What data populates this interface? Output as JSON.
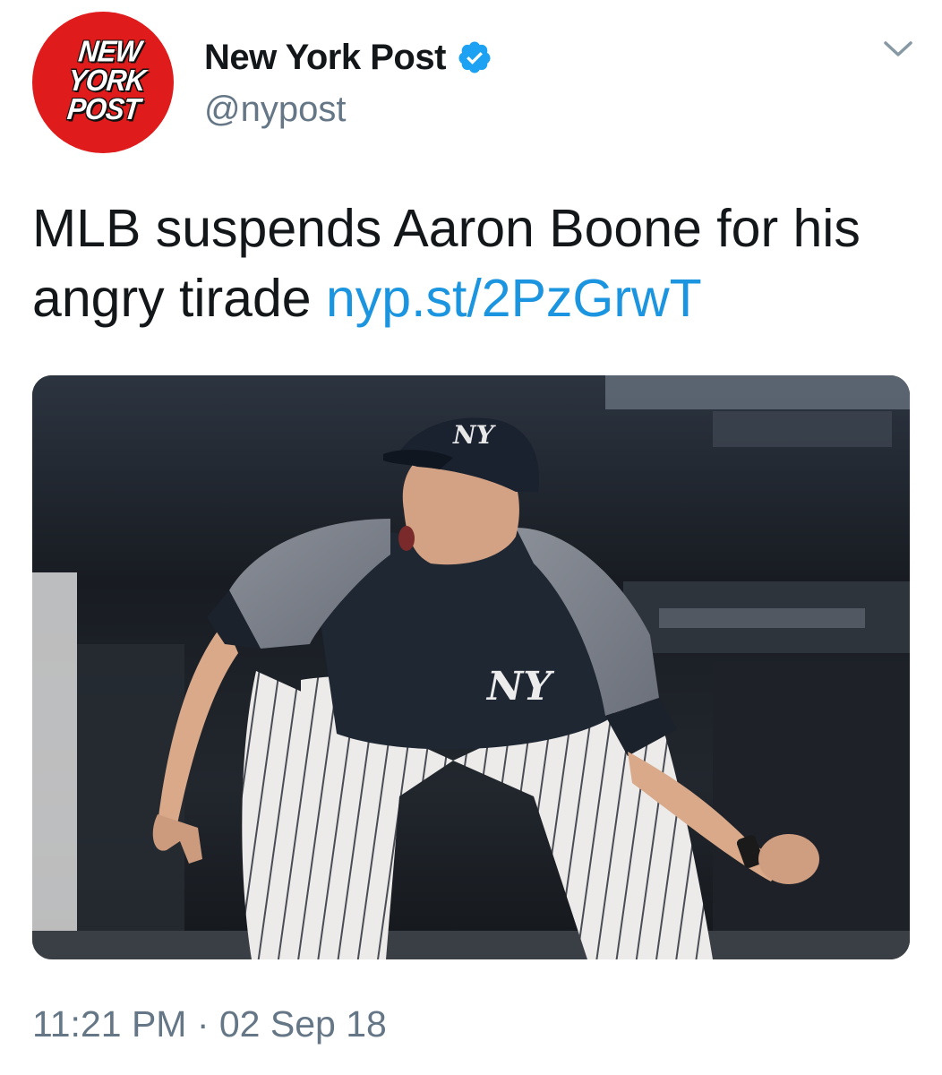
{
  "account": {
    "display_name": "New York Post",
    "handle": "@nypost",
    "verified": true,
    "avatar_logo_lines": [
      "NEW",
      "YORK",
      "POST"
    ],
    "avatar_color": "#e01b1b"
  },
  "tweet": {
    "text": "MLB suspends Aaron Boone for his angry tirade ",
    "link_text": "nyp.st/2PzGrwT",
    "link_color": "#1b95e0"
  },
  "media": {
    "type": "photo",
    "cap_logo": "NY",
    "jersey_logo": "NY"
  },
  "meta": {
    "timestamp": "11:21 PM · 02 Sep 18"
  },
  "icons": {
    "verified": "verified-badge-icon",
    "menu": "chevron-down-icon"
  }
}
